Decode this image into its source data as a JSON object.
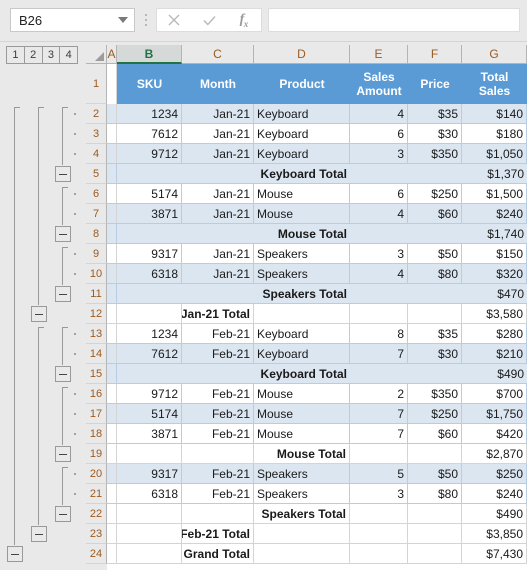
{
  "app": "excel-grid",
  "formula_bar": {
    "name_box_value": "B26",
    "name_box_dropdown_icon": "chevron-down-icon",
    "cancel_icon": "close-icon",
    "enter_icon": "checkmark-icon",
    "function_icon": "fx-icon",
    "function_label_main": "f",
    "function_label_sub": "x",
    "formula_value": ""
  },
  "outline": {
    "levels": [
      "1",
      "2",
      "3",
      "4"
    ],
    "collapse_icon": "minus-icon",
    "buttons_level3_rows": [
      5,
      8,
      11,
      15,
      19,
      22
    ],
    "buttons_level2_rows": [
      12,
      23
    ],
    "buttons_level1_rows": [
      24
    ]
  },
  "sheet": {
    "columns": [
      "A",
      "B",
      "C",
      "D",
      "E",
      "F",
      "G"
    ],
    "selected_column": "B",
    "row_numbers": [
      "1",
      "2",
      "3",
      "4",
      "5",
      "6",
      "7",
      "8",
      "9",
      "10",
      "11",
      "12",
      "13",
      "14",
      "15",
      "16",
      "17",
      "18",
      "19",
      "20",
      "21",
      "22",
      "23",
      "24"
    ],
    "header_row": {
      "sku": "SKU",
      "month": "Month",
      "product": "Product",
      "sales_amount_line1": "Sales",
      "sales_amount_line2": "Amount",
      "price": "Price",
      "total_sales_line1": "Total",
      "total_sales_line2": "Sales"
    },
    "colors": {
      "header_fill": "#5B9BD5",
      "band_fill": "#DCE6F1",
      "grid_line": "#B8CCE4",
      "selected_header": "#217346"
    },
    "rows": [
      {
        "n": "2",
        "type": "data",
        "band": true,
        "sku": "1234",
        "month": "Jan-21",
        "product": "Keyboard",
        "amount": "4",
        "price": "$35",
        "total": "$140"
      },
      {
        "n": "3",
        "type": "data",
        "band": false,
        "sku": "7612",
        "month": "Jan-21",
        "product": "Keyboard",
        "amount": "6",
        "price": "$30",
        "total": "$180"
      },
      {
        "n": "4",
        "type": "data",
        "band": true,
        "sku": "9712",
        "month": "Jan-21",
        "product": "Keyboard",
        "amount": "3",
        "price": "$350",
        "total": "$1,050"
      },
      {
        "n": "5",
        "type": "subtotal",
        "band": true,
        "label": "Keyboard Total",
        "label_col": "D",
        "total": "$1,370"
      },
      {
        "n": "6",
        "type": "data",
        "band": false,
        "sku": "5174",
        "month": "Jan-21",
        "product": "Mouse",
        "amount": "6",
        "price": "$250",
        "total": "$1,500"
      },
      {
        "n": "7",
        "type": "data",
        "band": true,
        "sku": "3871",
        "month": "Jan-21",
        "product": "Mouse",
        "amount": "4",
        "price": "$60",
        "total": "$240"
      },
      {
        "n": "8",
        "type": "subtotal",
        "band": true,
        "label": "Mouse Total",
        "label_col": "D",
        "total": "$1,740"
      },
      {
        "n": "9",
        "type": "data",
        "band": false,
        "sku": "9317",
        "month": "Jan-21",
        "product": "Speakers",
        "amount": "3",
        "price": "$50",
        "total": "$150"
      },
      {
        "n": "10",
        "type": "data",
        "band": true,
        "sku": "6318",
        "month": "Jan-21",
        "product": "Speakers",
        "amount": "4",
        "price": "$80",
        "total": "$320"
      },
      {
        "n": "11",
        "type": "subtotal",
        "band": true,
        "label": "Speakers Total",
        "label_col": "D",
        "total": "$470"
      },
      {
        "n": "12",
        "type": "grandsub",
        "band": false,
        "label": "Jan-21 Total",
        "label_col": "C",
        "total": "$3,580"
      },
      {
        "n": "13",
        "type": "data",
        "band": false,
        "sku": "1234",
        "month": "Feb-21",
        "product": "Keyboard",
        "amount": "8",
        "price": "$35",
        "total": "$280"
      },
      {
        "n": "14",
        "type": "data",
        "band": true,
        "sku": "7612",
        "month": "Feb-21",
        "product": "Keyboard",
        "amount": "7",
        "price": "$30",
        "total": "$210"
      },
      {
        "n": "15",
        "type": "subtotal",
        "band": true,
        "label": "Keyboard Total",
        "label_col": "D",
        "total": "$490"
      },
      {
        "n": "16",
        "type": "data",
        "band": false,
        "sku": "9712",
        "month": "Feb-21",
        "product": "Mouse",
        "amount": "2",
        "price": "$350",
        "total": "$700"
      },
      {
        "n": "17",
        "type": "data",
        "band": true,
        "sku": "5174",
        "month": "Feb-21",
        "product": "Mouse",
        "amount": "7",
        "price": "$250",
        "total": "$1,750"
      },
      {
        "n": "18",
        "type": "data",
        "band": false,
        "sku": "3871",
        "month": "Feb-21",
        "product": "Mouse",
        "amount": "7",
        "price": "$60",
        "total": "$420"
      },
      {
        "n": "19",
        "type": "subtotal",
        "band": false,
        "label": "Mouse Total",
        "label_col": "D",
        "total": "$2,870"
      },
      {
        "n": "20",
        "type": "data",
        "band": true,
        "sku": "9317",
        "month": "Feb-21",
        "product": "Speakers",
        "amount": "5",
        "price": "$50",
        "total": "$250"
      },
      {
        "n": "21",
        "type": "data",
        "band": false,
        "sku": "6318",
        "month": "Feb-21",
        "product": "Speakers",
        "amount": "3",
        "price": "$80",
        "total": "$240"
      },
      {
        "n": "22",
        "type": "subtotal",
        "band": false,
        "label": "Speakers Total",
        "label_col": "D",
        "total": "$490"
      },
      {
        "n": "23",
        "type": "grandsub",
        "band": false,
        "label": "Feb-21 Total",
        "label_col": "C",
        "total": "$3,850"
      },
      {
        "n": "24",
        "type": "grandsub",
        "band": false,
        "label": "Grand Total",
        "label_col": "C",
        "total": "$7,430"
      }
    ]
  }
}
